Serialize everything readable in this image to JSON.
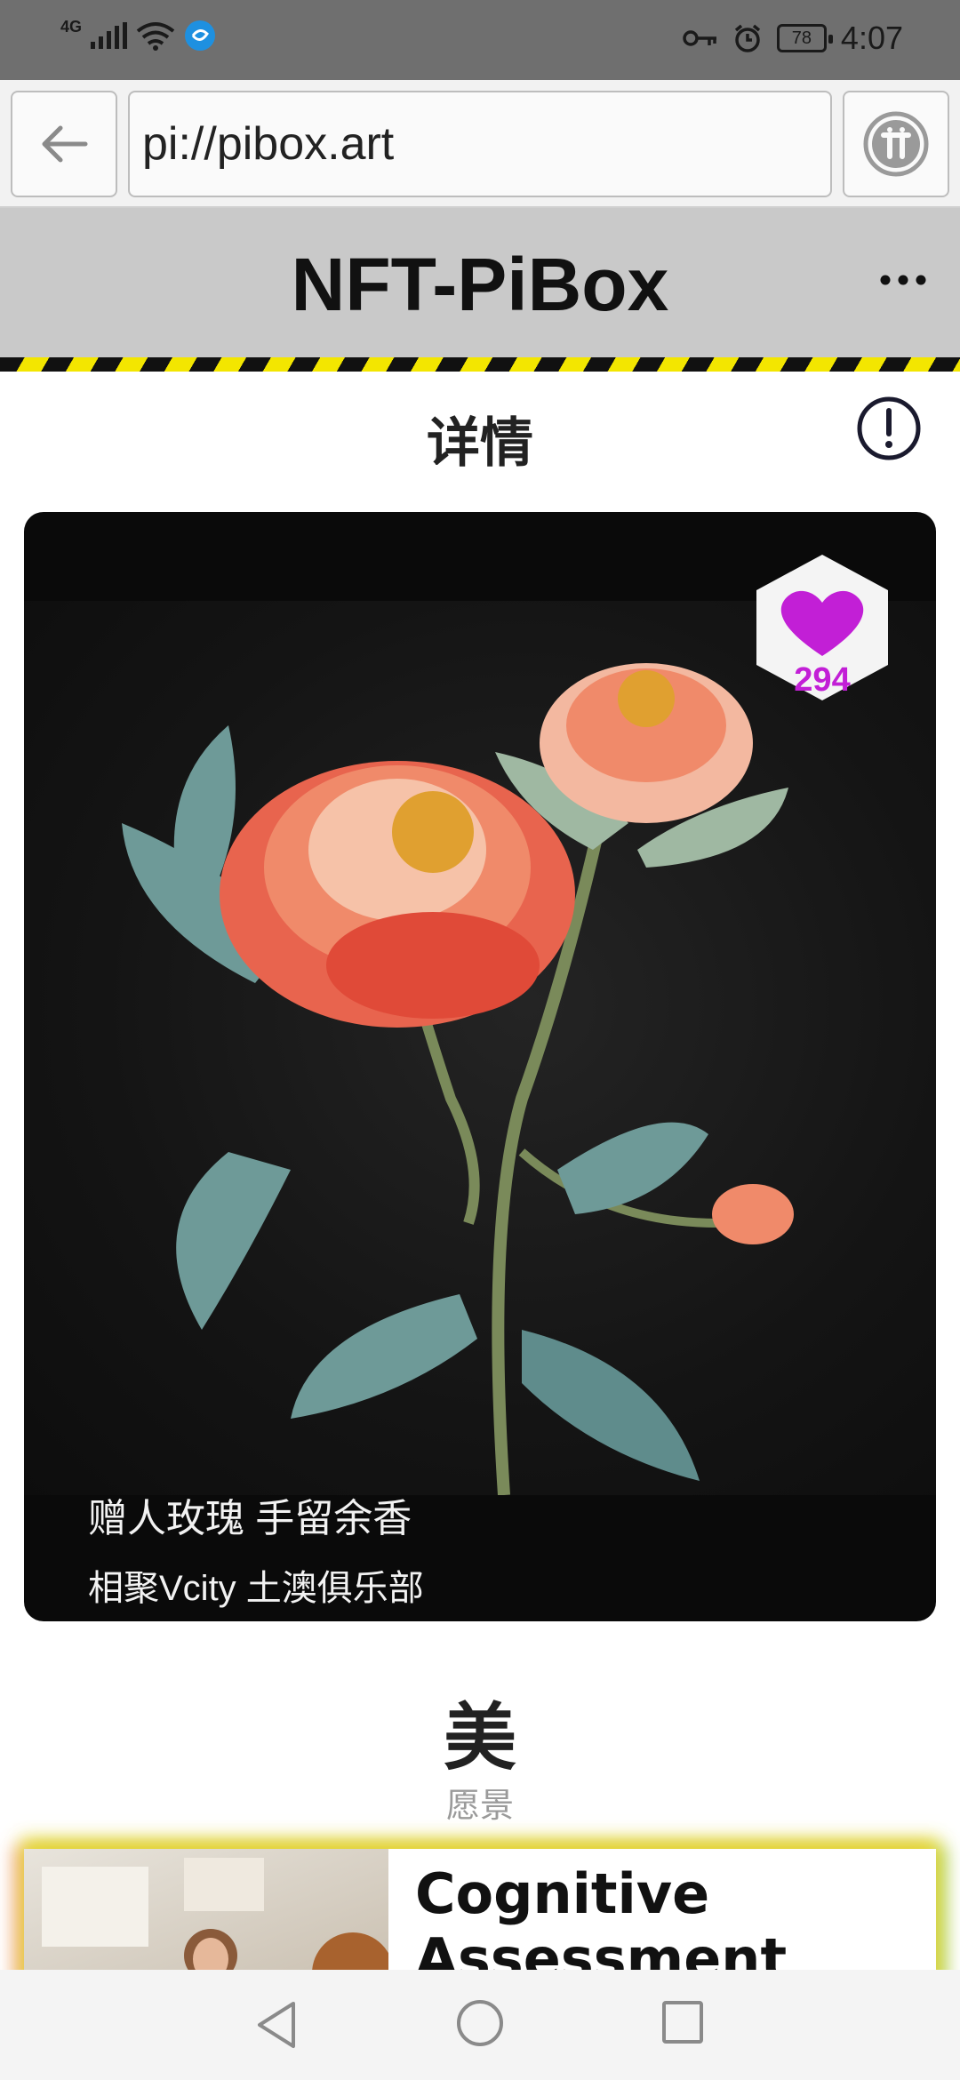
{
  "status_bar": {
    "network": "4G",
    "battery": "78",
    "time": "4:07"
  },
  "browser": {
    "url": "pi://pibox.art"
  },
  "header": {
    "title": "NFT-PiBox"
  },
  "detail": {
    "title": "详情"
  },
  "nft": {
    "likes": "294",
    "caption_line1": "赠人玫瑰 手留余香",
    "caption_line2": "相聚Vcity 土澳俱乐部"
  },
  "section": {
    "title": "美",
    "subtitle": "愿景"
  },
  "ad": {
    "title": "Cognitive Assessment Tests"
  },
  "colors": {
    "heart": "#c21fd6",
    "hazard_yellow": "#f3e600",
    "header_bg": "#c9c9c9"
  },
  "icons": [
    "back-arrow-icon",
    "pi-logo-icon",
    "more-dots-icon",
    "info-icon",
    "heart-icon",
    "nav-back-icon",
    "nav-home-icon",
    "nav-recent-icon"
  ]
}
